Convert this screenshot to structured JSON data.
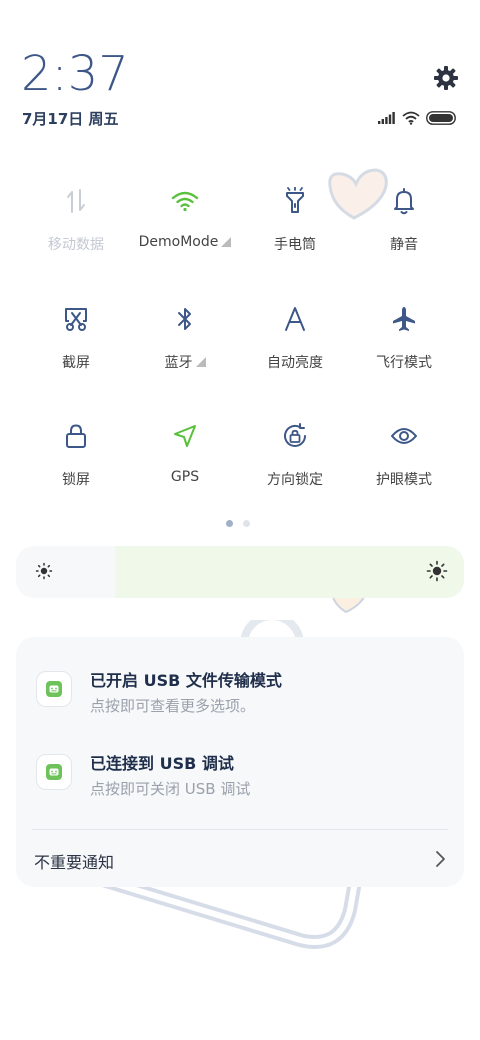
{
  "status": {
    "time": "2:37",
    "date": "7月17日 周五"
  },
  "tiles": [
    {
      "label": "移动数据",
      "icon": "mobile-data-icon",
      "state": "disabled"
    },
    {
      "label": "DemoMode",
      "icon": "wifi-icon",
      "state": "on",
      "expandable": true
    },
    {
      "label": "手电筒",
      "icon": "flashlight-icon",
      "state": "off"
    },
    {
      "label": "静音",
      "icon": "bell-icon",
      "state": "off"
    },
    {
      "label": "截屏",
      "icon": "screenshot-icon",
      "state": "off"
    },
    {
      "label": "蓝牙",
      "icon": "bluetooth-icon",
      "state": "off",
      "expandable": true
    },
    {
      "label": "自动亮度",
      "icon": "auto-brightness-icon",
      "state": "off"
    },
    {
      "label": "飞行模式",
      "icon": "airplane-icon",
      "state": "off"
    },
    {
      "label": "锁屏",
      "icon": "lock-icon",
      "state": "off"
    },
    {
      "label": "GPS",
      "icon": "gps-icon",
      "state": "on"
    },
    {
      "label": "方向锁定",
      "icon": "rotation-lock-icon",
      "state": "off"
    },
    {
      "label": "护眼模式",
      "icon": "eye-icon",
      "state": "off"
    }
  ],
  "pager": {
    "pages": 2,
    "current": 1
  },
  "brightness": {
    "level": 0.78
  },
  "notifications": [
    {
      "title": "已开启 USB 文件传输模式",
      "subtitle": "点按即可查看更多选项。",
      "icon": "android-icon"
    },
    {
      "title": "已连接到 USB 调试",
      "subtitle": "点按即可关闭 USB 调试",
      "icon": "android-icon"
    }
  ],
  "less_important": {
    "label": "不重要通知"
  },
  "colors": {
    "accent_on": "#58c03a",
    "icon": "#3d5788",
    "disabled": "#c3c9d3"
  }
}
